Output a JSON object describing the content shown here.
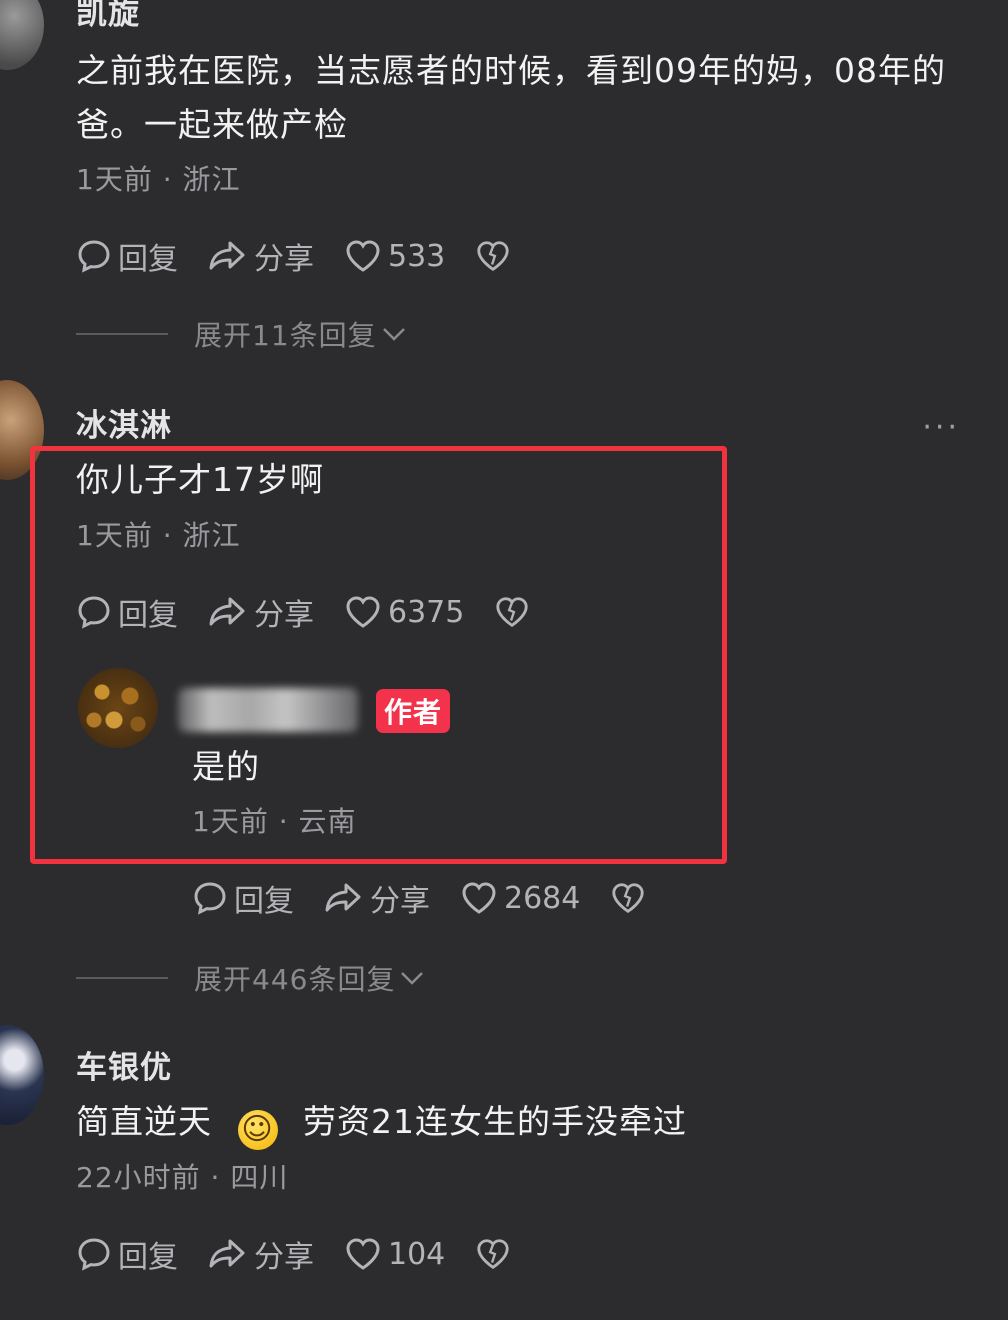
{
  "comments": [
    {
      "username": "凯旋",
      "content": "之前我在医院，当志愿者的时候，看到09年的妈，08年的爸。一起来做产检",
      "meta": "1天前 · 浙江",
      "reply_label": "回复",
      "share_label": "分享",
      "likes": "533",
      "expand_label": "展开11条回复"
    },
    {
      "username": "冰淇淋",
      "content": "你儿子才17岁啊",
      "meta": "1天前 · 浙江",
      "reply_label": "回复",
      "share_label": "分享",
      "likes": "6375",
      "more_label": "···",
      "author_reply": {
        "badge": "作者",
        "content": "是的",
        "meta": "1天前 · 云南",
        "reply_label": "回复",
        "share_label": "分享",
        "likes": "2684"
      },
      "expand_label": "展开446条回复"
    },
    {
      "username": "车银优",
      "content_before": "简直逆天",
      "emoji": "☺",
      "content_after": "劳资21连女生的手没牵过",
      "meta": "22小时前 · 四川",
      "reply_label": "回复",
      "share_label": "分享",
      "likes": "104"
    }
  ],
  "colors": {
    "background": "#2c2c2e",
    "highlight_border": "#f0333f",
    "author_badge": "#f2334b"
  }
}
